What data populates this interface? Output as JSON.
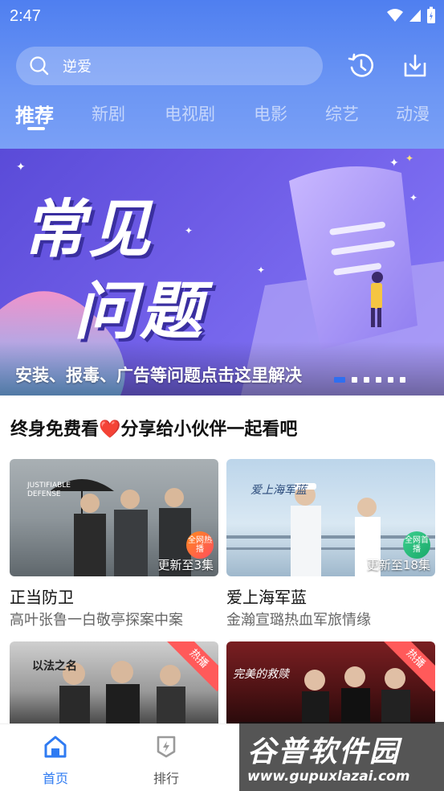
{
  "status": {
    "time": "2:47"
  },
  "search": {
    "text": "逆爱"
  },
  "tabs": [
    {
      "label": "推荐",
      "active": true
    },
    {
      "label": "新剧"
    },
    {
      "label": "电视剧"
    },
    {
      "label": "电影"
    },
    {
      "label": "综艺"
    },
    {
      "label": "动漫"
    }
  ],
  "banner": {
    "title_line1": "常见",
    "title_line2": "问题",
    "caption": "安装、报毒、广告等问题点击这里解决",
    "active_slide": 1,
    "slide_count": 6
  },
  "section": {
    "title": "终身免费看❤️分享给小伙伴一起看吧"
  },
  "cards": [
    {
      "title": "正当防卫",
      "subtitle": "高叶张鲁一白敬亭探案中案",
      "episode": "更新至3集",
      "badge": "全网热播",
      "poster_text": "JUSTIFIABLE DEFENSE"
    },
    {
      "title": "爱上海军蓝",
      "subtitle": "金瀚宣璐热血军旅情缘",
      "episode": "更新至18集",
      "badge": "全网首播",
      "poster_text": "爱上海军蓝"
    },
    {
      "ribbon": "热播",
      "poster_text": "以法之名"
    },
    {
      "ribbon": "热播",
      "poster_text": "完美的救赎"
    }
  ],
  "bottom_nav": [
    {
      "label": "首页",
      "icon": "home-icon",
      "active": true
    },
    {
      "label": "排行",
      "icon": "rank-icon"
    }
  ],
  "watermark": {
    "cn": "谷普软件园",
    "en": "www.gupuxlazai.com"
  },
  "colors": {
    "accent": "#2f7bf2",
    "header_blue": "#5b8af2",
    "banner_purple": "#6e5ce6",
    "ribbon_red": "#ff5a5a"
  }
}
